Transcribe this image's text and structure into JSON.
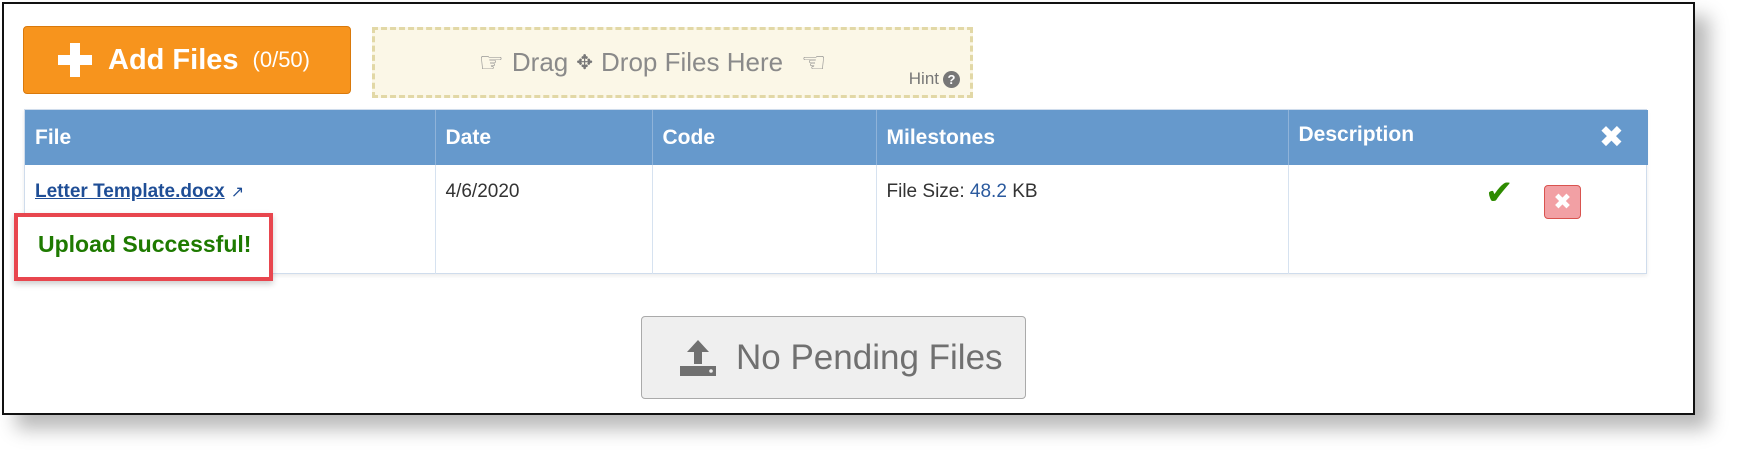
{
  "toolbar": {
    "add_files_label": "Add Files",
    "add_files_count": "(0/50)",
    "dropzone_drag": "Drag",
    "dropzone_drop": "Drop Files Here",
    "hint_label": "Hint"
  },
  "table": {
    "headers": [
      "File",
      "Date",
      "Code",
      "Milestones",
      "Description"
    ],
    "rows": [
      {
        "file_name": "Letter Template.docx",
        "status": "Upload Successful!",
        "date": "4/6/2020",
        "code": "",
        "file_size_label": "File Size:",
        "file_size_value": "48.2",
        "file_size_unit": "KB"
      }
    ]
  },
  "pending": {
    "label": "No Pending Files"
  },
  "colors": {
    "add_button": "#f7941d",
    "table_header": "#6699cc",
    "success_text": "#1e7a00",
    "highlight_border": "#e8464e",
    "check": "#2e8b00"
  }
}
